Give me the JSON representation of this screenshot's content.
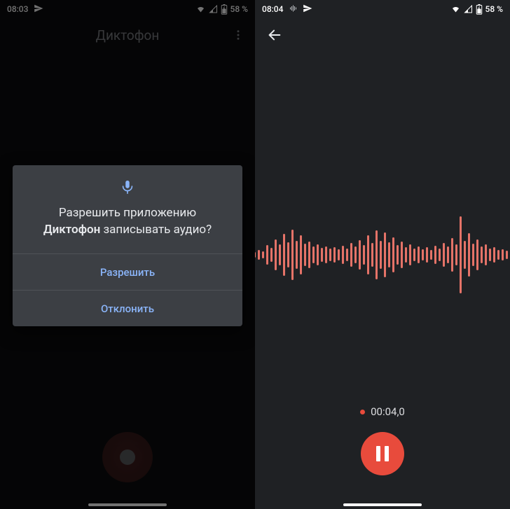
{
  "left": {
    "status": {
      "time": "08:03",
      "battery_text": "58 %"
    },
    "app_title": "Диктофон",
    "dialog": {
      "line1": "Разрешить приложению",
      "app_name": "Диктофон",
      "line2_rest": " записывать аудио?",
      "allow": "Разрешить",
      "deny": "Отклонить"
    }
  },
  "right": {
    "status": {
      "time": "08:04",
      "battery_text": "58 %"
    },
    "timer": "00:04,0",
    "waveform_heights": [
      6,
      5,
      8,
      6,
      10,
      8,
      14,
      10,
      28,
      20,
      44,
      30,
      60,
      36,
      72,
      40,
      56,
      32,
      38,
      24,
      30,
      20,
      24,
      18,
      22,
      16,
      26,
      18,
      34,
      24,
      42,
      28,
      56,
      34,
      70,
      40,
      64,
      36,
      50,
      28,
      38,
      22,
      30,
      18,
      24,
      16,
      22,
      14,
      26,
      18,
      34,
      24,
      48,
      30,
      110,
      40,
      62,
      32,
      44,
      24,
      30,
      18,
      22,
      14,
      16,
      12,
      12,
      10,
      10,
      8,
      8,
      6
    ]
  },
  "colors": {
    "accent_blue": "#8ab4f8",
    "wave": "#e57368",
    "record_red": "#e84b3c"
  }
}
